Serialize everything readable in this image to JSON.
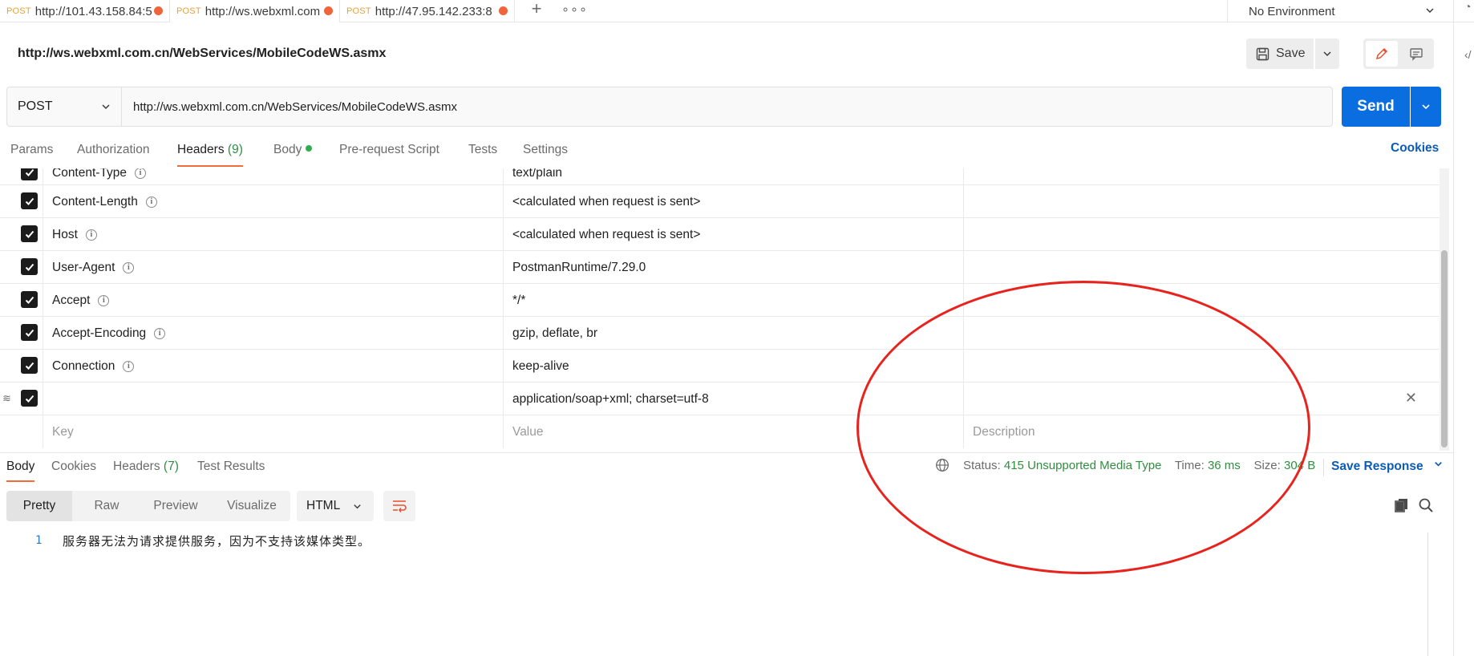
{
  "tabs": [
    {
      "method": "POST",
      "url": "http://101.43.158.84:5",
      "unsaved": true
    },
    {
      "method": "POST",
      "url": "http://ws.webxml.com",
      "unsaved": true,
      "active": true
    },
    {
      "method": "POST",
      "url": "http://47.95.142.233:8",
      "unsaved": true
    }
  ],
  "tab_actions": {
    "new": "+",
    "more": "∘∘∘"
  },
  "environment": {
    "label": "No Environment"
  },
  "request": {
    "title": "http://ws.webxml.com.cn/WebServices/MobileCodeWS.asmx",
    "save_label": "Save",
    "method": "POST",
    "url": "http://ws.webxml.com.cn/WebServices/MobileCodeWS.asmx",
    "send_label": "Send"
  },
  "request_tabs": {
    "params": "Params",
    "authorization": "Authorization",
    "headers": "Headers",
    "headers_count": "(9)",
    "body": "Body",
    "pre_request": "Pre-request Script",
    "tests": "Tests",
    "settings": "Settings",
    "cookies": "Cookies"
  },
  "headers_rows": [
    {
      "key": "Content-Type",
      "value": "text/plain",
      "info": true
    },
    {
      "key": "Content-Length",
      "value": "<calculated when request is sent>",
      "info": true
    },
    {
      "key": "Host",
      "value": "<calculated when request is sent>",
      "info": true
    },
    {
      "key": "User-Agent",
      "value": "PostmanRuntime/7.29.0",
      "info": true
    },
    {
      "key": "Accept",
      "value": "*/*",
      "info": true
    },
    {
      "key": "Accept-Encoding",
      "value": "gzip, deflate, br",
      "info": true
    },
    {
      "key": "Connection",
      "value": "keep-alive",
      "info": true
    },
    {
      "key": "",
      "value": "application/soap+xml; charset=utf-8",
      "info": false
    }
  ],
  "new_row": {
    "key_placeholder": "Key",
    "value_placeholder": "Value",
    "description_placeholder": "Description"
  },
  "response": {
    "tabs": {
      "body": "Body",
      "cookies": "Cookies",
      "headers": "Headers",
      "headers_count": "(7)",
      "test_results": "Test Results"
    },
    "status_label": "Status:",
    "status_value": "415 Unsupported Media Type",
    "time_label": "Time:",
    "time_value": "36 ms",
    "size_label": "Size:",
    "size_value": "304 B",
    "save_response": "Save Response",
    "views": {
      "pretty": "Pretty",
      "raw": "Raw",
      "preview": "Preview",
      "visualize": "Visualize"
    },
    "language": "HTML",
    "line_number": "1",
    "body_text": "服务器无法为请求提供服务，因为不支持该媒体类型。"
  },
  "colors": {
    "accent": "#0b6ee0",
    "tab_indicator": "#f26b3a",
    "status_ok": "#2f8f3f",
    "annotation": "#e8231e"
  }
}
